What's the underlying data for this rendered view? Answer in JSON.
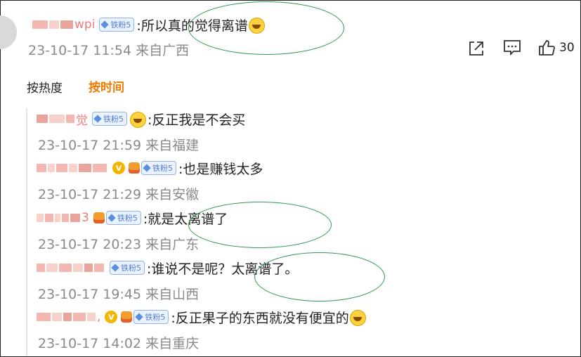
{
  "main_comment": {
    "user_fragment": "wpi",
    "fan_badge": "铁粉5",
    "text": ":所以真的觉得离谱",
    "meta": "23-10-17 11:54 来自广西",
    "like_count": "30"
  },
  "sort_tabs": {
    "by_hot": "按热度",
    "by_time": "按时间"
  },
  "replies": [
    {
      "user_fragment": "觉",
      "fan_badge": "铁粉5",
      "text": ":反正我是不会买",
      "meta": "23-10-17 21:59 来自福建"
    },
    {
      "user_fragment": "",
      "fan_badge": "铁粉5",
      "text": ":也是赚钱太多",
      "meta": "23-10-17 21:29 来自安徽"
    },
    {
      "user_fragment": "3",
      "fan_badge": "铁粉5",
      "text": ":就是太离谱了",
      "meta": "23-10-17 20:23 来自广东"
    },
    {
      "user_fragment": "",
      "fan_badge": "铁粉5",
      "text": ":谁说不是呢？太离谱了。",
      "meta": "23-10-17 19:45 来自山西"
    },
    {
      "user_fragment": ",",
      "fan_badge": "铁粉5",
      "text": ":反正果子的东西就没有便宜的",
      "meta": "23-10-17 14:02 来自重庆"
    }
  ],
  "colors": {
    "accent": "#f07a00",
    "annotation": "#2e9a4a",
    "meta": "#8a8a8a"
  },
  "icons": {
    "share": "share-icon",
    "comment": "comment-icon",
    "like": "like-icon"
  }
}
